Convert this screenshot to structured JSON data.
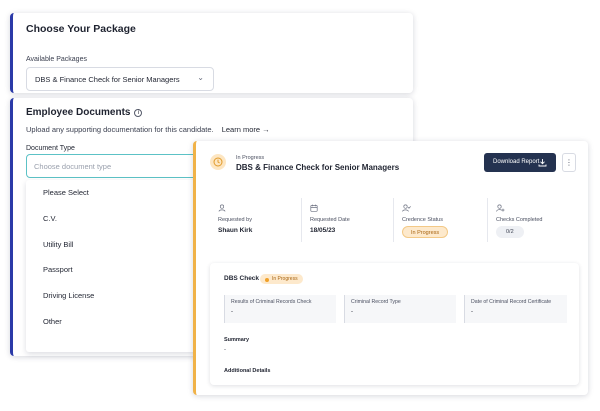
{
  "package": {
    "title": "Choose Your Package",
    "available_label": "Available Packages",
    "selected": "DBS & Finance Check for Senior Managers"
  },
  "documents": {
    "title": "Employee Documents",
    "description": "Upload any supporting documentation for this candidate.",
    "learn_more": "Learn more →",
    "type_label": "Document Type",
    "type_placeholder": "Choose document type",
    "options": [
      "Please Select",
      "C.V.",
      "Utility Bill",
      "Passport",
      "Driving License",
      "Other"
    ]
  },
  "report": {
    "status": "In Progress",
    "title": "DBS & Finance Check for Senior Managers",
    "download_label": "Download Report",
    "more_label": "⋮",
    "stats": {
      "requested_by_label": "Requested by",
      "requested_by": "Shaun Kirk",
      "requested_date_label": "Requested Date",
      "requested_date": "18/05/23",
      "credence_label": "Credence Status",
      "credence": "In Progress",
      "checks_label": "Checks Completed",
      "checks": "0/2"
    },
    "check": {
      "title": "DBS Check",
      "status": "In Progress",
      "fields": [
        {
          "label": "Results of Criminal Records Check",
          "value": "-"
        },
        {
          "label": "Criminal Record Type",
          "value": "-"
        },
        {
          "label": "Date of Criminal Record Certificate",
          "value": "-"
        }
      ],
      "summary_label": "Summary",
      "summary_value": "-",
      "additional_label": "Additional Details"
    }
  },
  "colors": {
    "accent_blue": "#2b3aa8",
    "accent_orange": "#f0b248",
    "teal_focus": "#5cc2c6",
    "button_dark": "#243250"
  }
}
